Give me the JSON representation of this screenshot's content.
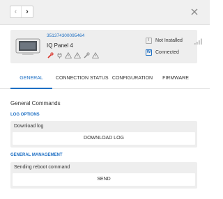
{
  "nav": {
    "prev_glyph": "‹",
    "next_glyph": "›",
    "prev_icon": "chevron-left-icon",
    "next_icon": "chevron-right-icon",
    "close_icon": "close-icon"
  },
  "device": {
    "serial": "351374300095464",
    "name": "IQ Panel 4",
    "status_icons": [
      "wrench-icon",
      "power-plug-icon",
      "warning-icon",
      "warning-icon",
      "wrench-icon",
      "warning-icon"
    ],
    "install_status": "Not Installed",
    "install_badge": "I",
    "connection_status": "Connected",
    "connection_badge": "W",
    "signal_icon": "signal-bars-icon"
  },
  "tabs": [
    {
      "label": "GENERAL",
      "active": true
    },
    {
      "label": "CONNECTION STATUS",
      "active": false
    },
    {
      "label": "CONFIGURATION",
      "active": false
    },
    {
      "label": "FIRMWARE",
      "active": false
    }
  ],
  "content": {
    "section_title": "General Commands",
    "log_options": {
      "group_label": "LOG OPTIONS",
      "label": "Download log",
      "button": "DOWNLOAD LOG"
    },
    "general_management": {
      "group_label": "GENERAL MANAGEMENT",
      "label": "Sending reboot command",
      "button": "SEND"
    }
  },
  "colors": {
    "accent": "#1d6fc4",
    "alert_red": "#d9342b",
    "panel_bg": "#eeeeee"
  }
}
